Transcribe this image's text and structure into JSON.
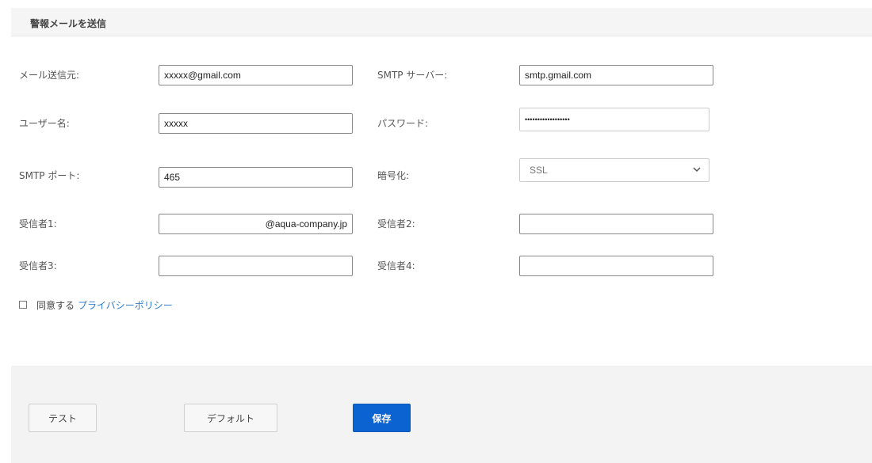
{
  "section": {
    "title": "警報メールを送信"
  },
  "form": {
    "sender": {
      "label": "メール送信元:",
      "value": "xxxxx@gmail.com"
    },
    "smtp_server": {
      "label": "SMTP サーバー:",
      "value": "smtp.gmail.com"
    },
    "username": {
      "label": "ユーザー名:",
      "value": "xxxxx"
    },
    "password": {
      "label": "パスワード:",
      "value": "••••••••••••••••••"
    },
    "smtp_port": {
      "label": "SMTP ポート:",
      "value": "465"
    },
    "encryption": {
      "label": "暗号化:",
      "value": "SSL",
      "icon": "chevron-down-icon"
    },
    "recipient1": {
      "label": "受信者1:",
      "value": "@aqua-company.jp"
    },
    "recipient2": {
      "label": "受信者2:",
      "value": ""
    },
    "recipient3": {
      "label": "受信者3:",
      "value": ""
    },
    "recipient4": {
      "label": "受信者4:",
      "value": ""
    }
  },
  "consent": {
    "text": "同意する",
    "link": "プライバシーポリシー",
    "checked": false
  },
  "buttons": {
    "test": "テスト",
    "default": "デフォルト",
    "save": "保存"
  },
  "colors": {
    "primary": "#0b62d1",
    "link": "#2f7fd1",
    "footer_bg": "#f3f3f3",
    "header_bg": "#f5f5f5"
  }
}
